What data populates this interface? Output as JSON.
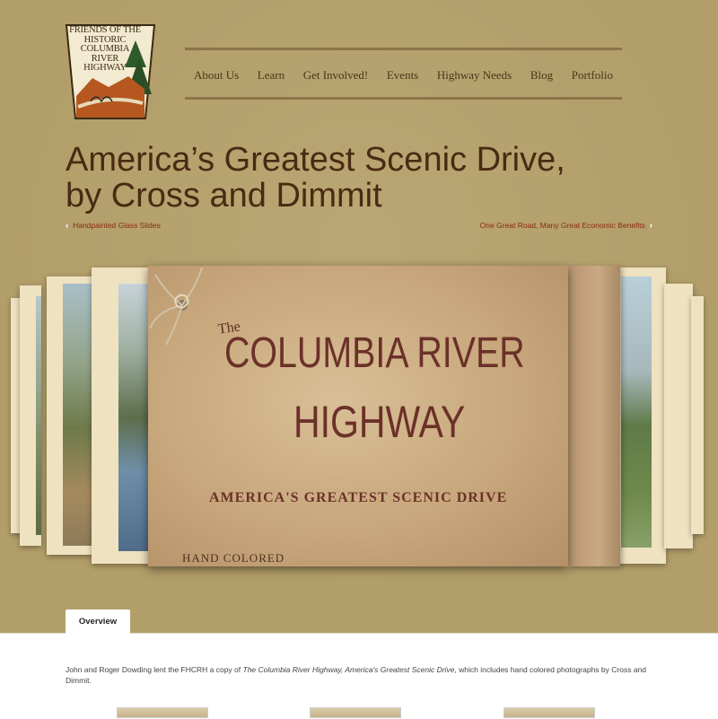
{
  "logo": {
    "lines": [
      "FRIENDS OF THE",
      "HISTORIC",
      "COLUMBIA",
      "RIVER",
      "HIGHWAY"
    ]
  },
  "nav": {
    "items": [
      "About Us",
      "Learn",
      "Get Involved!",
      "Events",
      "Highway Needs",
      "Blog",
      "Portfolio"
    ]
  },
  "page": {
    "title_line1": "America’s Greatest Scenic Drive,",
    "title_line2": "by Cross and Dimmit",
    "prev_link": "Handpainted Glass Slides",
    "next_link": "One Great Road, Many Great Economic Benefits"
  },
  "cover": {
    "the": "The",
    "line1": "COLUMBIA RIVER",
    "line2": "HIGHWAY",
    "subtitle": "AMERICA'S GREATEST SCENIC DRIVE",
    "hand_colored": "HAND COLORED"
  },
  "tabs": {
    "overview": "Overview"
  },
  "content": {
    "desc_before": "John and Roger Dowding lent the FHCRH a copy of ",
    "desc_italic": "The Columbia River Highway, America's Greatest Scenic Drive",
    "desc_after": ", which includes hand colored photographs by Cross and Dimmit."
  },
  "colors": {
    "background": "#b29e69",
    "title": "#4a2a12",
    "link": "#8c2a10",
    "cover_text": "#6b3128"
  }
}
